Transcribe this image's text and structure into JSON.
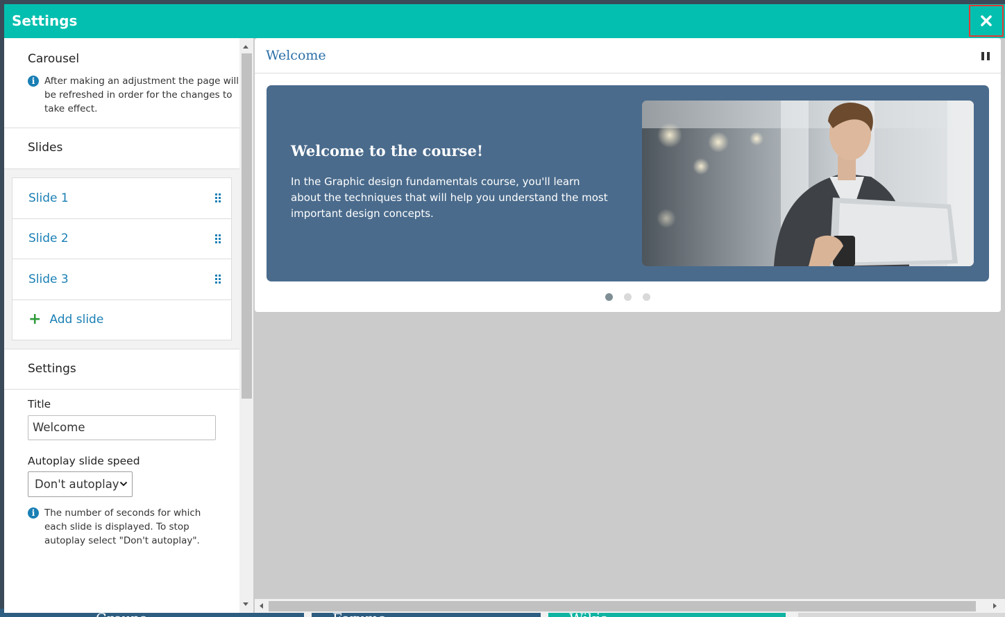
{
  "modal": {
    "title": "Settings",
    "close_icon": "close-icon"
  },
  "background_tabs": [
    "Groups",
    "Forums",
    "Wikis"
  ],
  "left": {
    "carousel": {
      "heading": "Carousel",
      "info": "After making an adjustment the page will be refreshed in order for the changes to take effect."
    },
    "slides": {
      "heading": "Slides",
      "items": [
        "Slide 1",
        "Slide 2",
        "Slide 3"
      ],
      "add_label": "Add slide"
    },
    "settings": {
      "heading": "Settings",
      "title_label": "Title",
      "title_value": "Welcome",
      "autoplay_label": "Autoplay slide speed",
      "autoplay_value": "Don't autoplay",
      "autoplay_info": "The number of seconds for which each slide is displayed. To stop autoplay select \"Don't autoplay\"."
    }
  },
  "preview": {
    "title": "Welcome",
    "slide": {
      "heading": "Welcome to the course!",
      "body": "In the Graphic design fundamentals course, you'll learn about the techniques that will help you understand the most important design concepts."
    },
    "dots_count": 3,
    "active_dot": 1
  },
  "colors": {
    "titlebar": "#03bfaf",
    "link": "#1a7fb4",
    "slide_bg": "#4a6b8c",
    "close_highlight": "#e53935"
  }
}
